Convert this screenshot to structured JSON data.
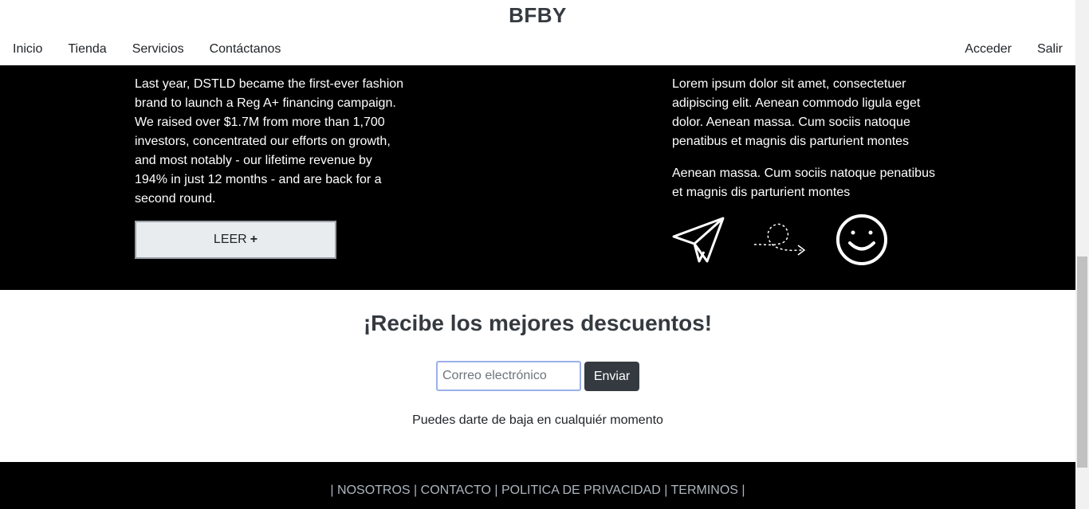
{
  "header": {
    "brand": "BFBY",
    "nav_left": [
      "Inicio",
      "Tienda",
      "Servicios",
      "Contáctanos"
    ],
    "nav_right": [
      "Acceder",
      "Salir"
    ]
  },
  "promo": {
    "left_text": "Last year, DSTLD became the first-ever fashion brand to launch a Reg A+ financing campaign. We raised over $1.7M from more than 1,700 investors, concentrated our efforts on growth, and most notably - our lifetime revenue by 194% in just 12 months - and are back for a second round.",
    "button_label": "LEER",
    "button_plus": "+",
    "right_paragraph_1": "Lorem ipsum dolor sit amet, consectetuer adipiscing elit. Aenean commodo ligula eget dolor. Aenean massa. Cum sociis natoque penatibus et magnis dis parturient montes",
    "right_paragraph_2": "Aenean massa. Cum sociis natoque penatibus et magnis dis parturient montes",
    "icons": [
      "paper-plane-icon",
      "dashed-path-arrow-icon",
      "smiley-icon"
    ]
  },
  "newsletter": {
    "title": "¡Recibe los mejores descuentos!",
    "input_placeholder": "Correo electrónico",
    "input_value": "",
    "submit_label": "Enviar",
    "note": "Puedes darte de baja en cualquiér momento"
  },
  "footer": {
    "links": [
      "NOSOTROS",
      "CONTACTO",
      "POLITICA DE PRIVACIDAD",
      "TERMINOS"
    ],
    "separator": "|"
  }
}
